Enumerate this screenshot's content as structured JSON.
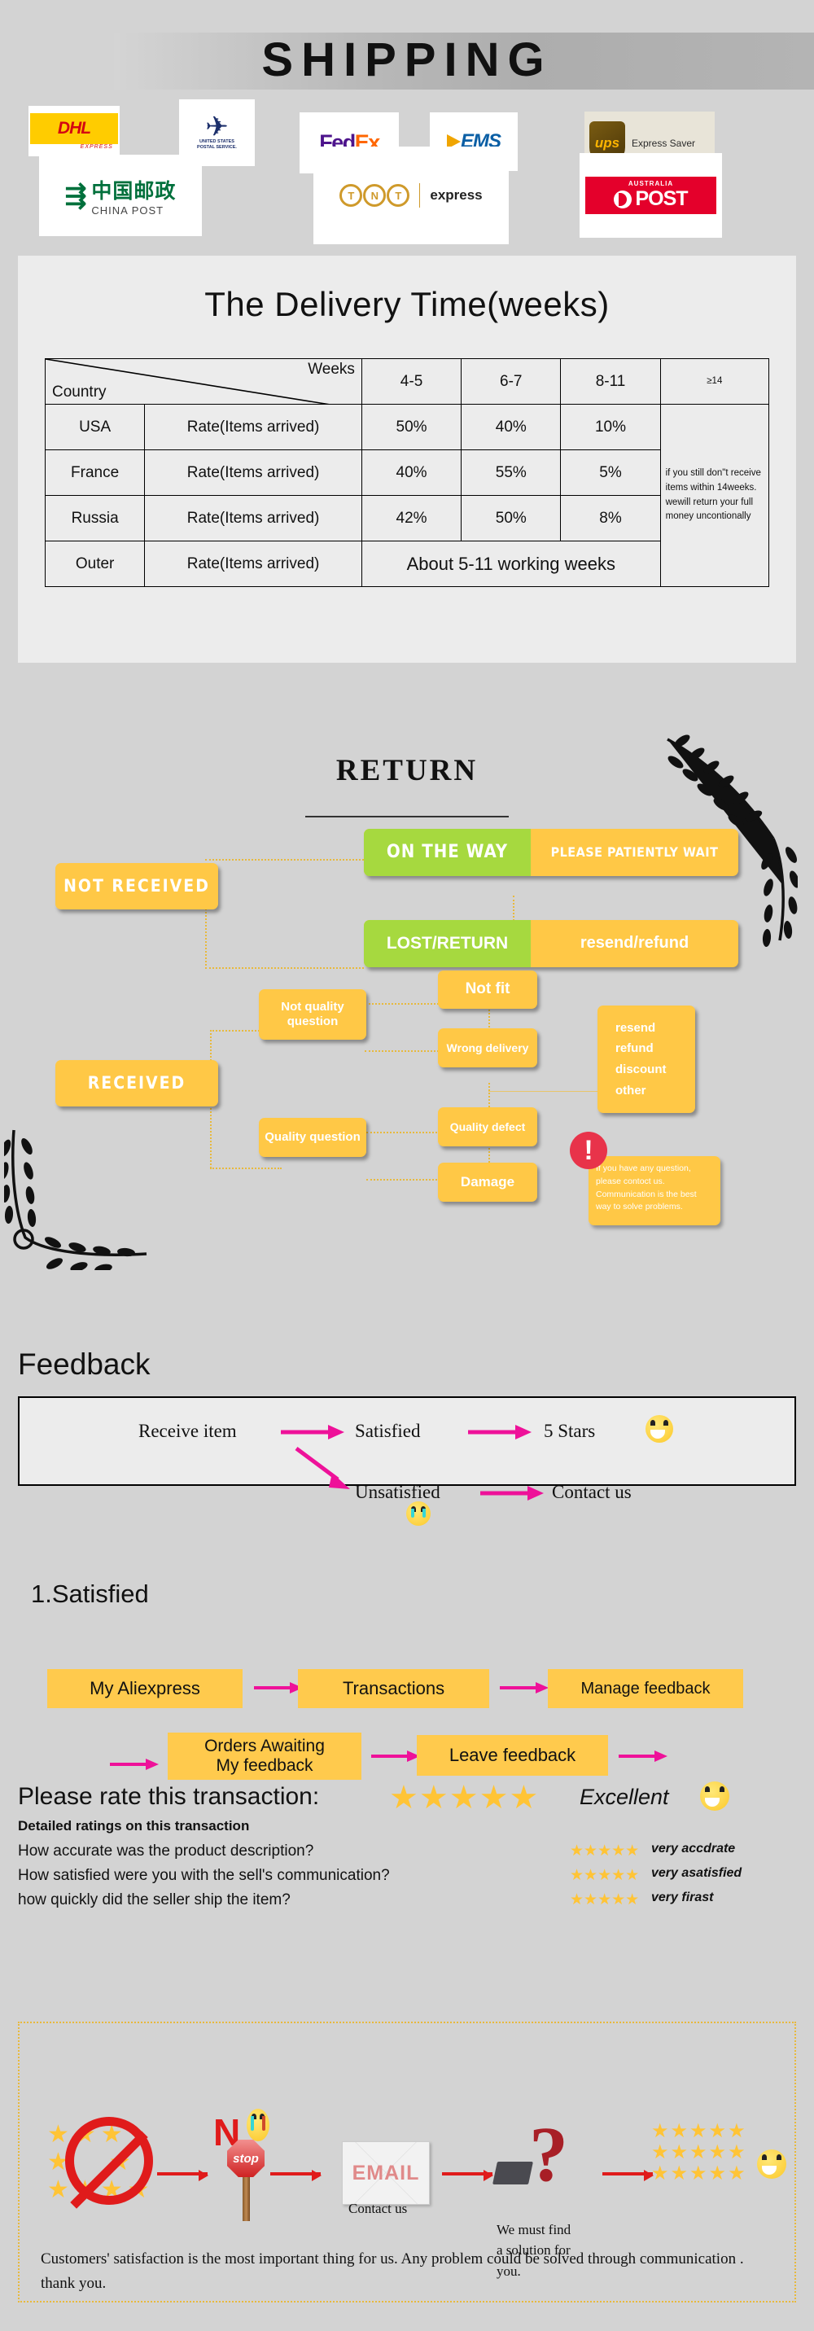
{
  "header": {
    "title": "SHIPPING"
  },
  "carriers": [
    {
      "name": "dhl",
      "label": "DHL",
      "sub": "EXPRESS"
    },
    {
      "name": "usps",
      "label": "UNITED STATES",
      "sub": "POSTAL SERVICE."
    },
    {
      "name": "fedex",
      "label_a": "Fed",
      "label_b": "Ex"
    },
    {
      "name": "ems",
      "label": "EMS"
    },
    {
      "name": "ups",
      "label": "ups",
      "sub": "Express Saver"
    },
    {
      "name": "china-post",
      "label": "中国邮政",
      "sub": "CHINA POST"
    },
    {
      "name": "tnt",
      "letters": [
        "T",
        "N",
        "T"
      ],
      "sub": "express"
    },
    {
      "name": "australia-post",
      "top": "AUSTRALIA",
      "label": "POST"
    }
  ],
  "delivery": {
    "title": "The Delivery Time(weeks)",
    "corner_row": "Weeks",
    "corner_col": "Country",
    "week_headers": [
      "4-5",
      "6-7",
      "8-11",
      "≥14"
    ],
    "rows": [
      {
        "country": "USA",
        "rate_label": "Rate(Items arrived)",
        "values": [
          "50%",
          "40%",
          "10%"
        ]
      },
      {
        "country": "France",
        "rate_label": "Rate(Items arrived)",
        "values": [
          "40%",
          "55%",
          "5%"
        ]
      },
      {
        "country": "Russia",
        "rate_label": "Rate(Items arrived)",
        "values": [
          "42%",
          "50%",
          "8%"
        ]
      },
      {
        "country": "Outer",
        "rate_label": "Rate(Items arrived)",
        "span_text": "About 5-11 working weeks"
      }
    ],
    "note": "if you still don\"t receive items within 14weeks. wewill return your full money uncontionally"
  },
  "return": {
    "title": "RETURN",
    "not_received": "NOT RECEIVED",
    "received": "RECEIVED",
    "on_the_way": "ON THE WAY",
    "on_the_way_action": "PLEASE PATIENTLY WAIT",
    "lost_return": "LOST/RETURN",
    "lost_return_action": "resend/refund",
    "not_quality": "Not quality question",
    "quality_question": "Quality question",
    "not_fit": "Not fit",
    "wrong_delivery": "Wrong delivery",
    "quality_defect": "Quality defect",
    "damage": "Damage",
    "outcomes": [
      "resend",
      "refund",
      "discount",
      "other"
    ],
    "alert_icon": "!",
    "alert_note": "If you have any question, please contoct us. Communication is the best way to solve problems."
  },
  "feedback": {
    "heading": "Feedback",
    "flow": {
      "receive_item": "Receive item",
      "satisfied": "Satisfied",
      "five_stars": "5 Stars",
      "unsatisfied": "Unsatisfied",
      "contact_us": "Contact us"
    },
    "satisfied_heading": "1.Satisfied",
    "steps_row1": [
      "My Aliexpress",
      "Transactions",
      "Manage feedback"
    ],
    "steps_row2": [
      "Orders Awaiting\nMy feedback",
      "Leave feedback"
    ]
  },
  "ratings": {
    "prompt": "Please rate this transaction:",
    "prompt_stars": "★★★★★",
    "prompt_label": "Excellent",
    "detail_heading": "Detailed ratings on this transaction",
    "items": [
      {
        "question": "How accurate was the product description?",
        "stars": "★★★★★",
        "label": "very accdrate"
      },
      {
        "question": "How satisfied were you with the sell's communication?",
        "stars": "★★★★★",
        "label": "very asatisfied"
      },
      {
        "question": "how quickly did the seller ship the item?",
        "stars": "★★★★★",
        "label": "very firast"
      }
    ]
  },
  "banner": {
    "no_letter": "N",
    "stop_label": "stop",
    "email_label": "EMAIL",
    "qmark": "?",
    "stars_grid": "★★★★★",
    "caption_contact": "Contact us",
    "caption_solution": "We must find\na solution for\nyou.",
    "footer": "Customers' satisfaction is the most important thing for us. Any problem could be solved through communication . thank you."
  },
  "colors": {
    "accent_yellow": "#ffc846",
    "accent_green": "#a6d93f",
    "alert_red": "#e8334a",
    "magenta": "#ee1199",
    "star": "#ffc436"
  }
}
